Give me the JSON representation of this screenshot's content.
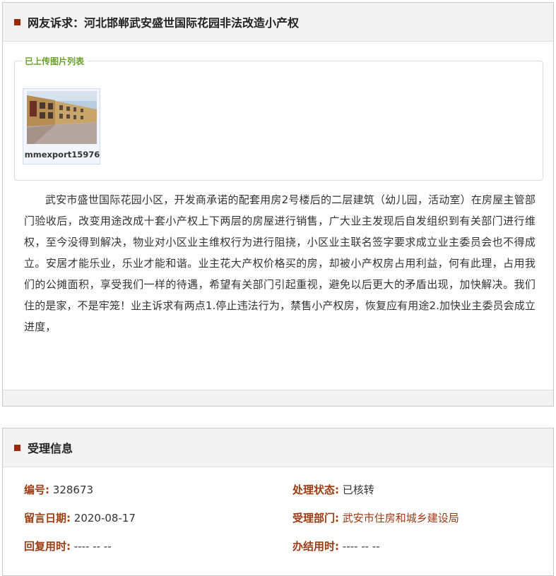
{
  "complaint": {
    "title": "网友诉求：河北邯郸武安盛世国际花园非法改造小产权",
    "images_legend": "已上传图片列表",
    "images": [
      {
        "caption": "mmexport15976"
      }
    ],
    "body": "武安市盛世国际花园小区，开发商承诺的配套用房2号楼后的二层建筑（幼儿园，活动室）在房屋主管部门验收后，改变用途改成十套小产权上下两层的房屋进行销售，广大业主发现后自发组织到有关部门进行维权，至今没得到解决，物业对小区业主维权行为进行阻挠，小区业主联名签字要求成立业主委员会也不得成立。安居才能乐业，乐业才能和谐。业主花大产权价格买的房，却被小产权房占用利益，何有此理，占用我们的公摊面积，享受我们一样的待遇，希望有关部门引起重视，避免以后更大的矛盾出现，加快解决。我们住的是家，不是牢笼！业主诉求有两点1.停止违法行为，禁售小产权房，恢复应有用途2.加快业主委员会成立进度，"
  },
  "acceptance": {
    "title": "受理信息",
    "id_label": "编号:",
    "id_value": "328673",
    "status_label": "处理状态:",
    "status_value": "已核转",
    "date_label": "留言日期:",
    "date_value": "2020-08-17",
    "dept_label": "受理部门:",
    "dept_value": "武安市住房和城乡建设局",
    "reply_label": "回复用时:",
    "reply_value": "---- -- --",
    "finish_label": "办结用时:",
    "finish_value": "---- -- --"
  },
  "colors": {
    "accent": "#9a2a0b",
    "label": "#9a3b12",
    "legend": "#6aa02a"
  }
}
